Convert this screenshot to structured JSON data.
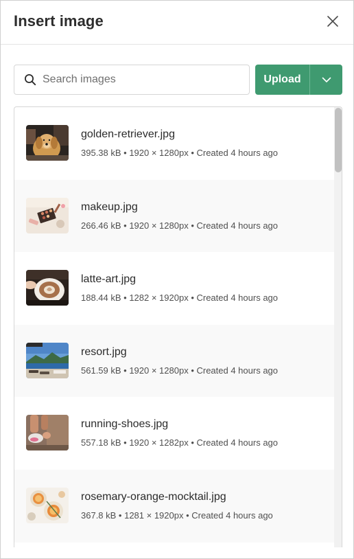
{
  "dialog": {
    "title": "Insert image"
  },
  "search": {
    "placeholder": "Search images",
    "value": ""
  },
  "upload": {
    "label": "Upload"
  },
  "images": [
    {
      "name": "golden-retriever.jpg",
      "meta": "395.38 kB • 1920 × 1280px • Created 4 hours ago"
    },
    {
      "name": "makeup.jpg",
      "meta": "266.46 kB • 1920 × 1280px • Created 4 hours ago"
    },
    {
      "name": "latte-art.jpg",
      "meta": "188.44 kB • 1282 × 1920px • Created 4 hours ago"
    },
    {
      "name": "resort.jpg",
      "meta": "561.59 kB • 1920 × 1280px • Created 4 hours ago"
    },
    {
      "name": "running-shoes.jpg",
      "meta": "557.18 kB • 1920 × 1282px • Created 4 hours ago"
    },
    {
      "name": "rosemary-orange-mocktail.jpg",
      "meta": "367.8 kB • 1281 × 1920px • Created 4 hours ago"
    }
  ],
  "colors": {
    "accent": "#3f9a70",
    "text": "#2b2b2b",
    "meta_text": "#4f4f4f",
    "row_alt": "#f9f9f9"
  },
  "icons": {
    "close": "close-icon",
    "search": "search-icon",
    "dropdown": "chevron-down-icon"
  }
}
